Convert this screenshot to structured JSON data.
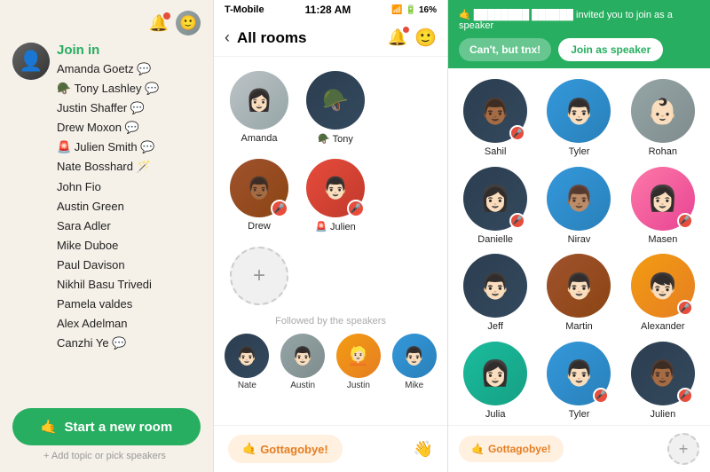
{
  "left": {
    "join_label": "Join in",
    "names": [
      "Amanda Goetz 💬",
      "🪖 Tony Lashley 💬",
      "Justin Shaffer 💬",
      "Drew Moxon 💬",
      "🚨 Julien Smith 💬",
      "Nate Bosshard 🪄",
      "John Fio",
      "Austin Green",
      "Sara Adler",
      "Mike Duboe",
      "Paul Davison",
      "Nikhil Basu Trivedi",
      "Pamela valdes",
      "Alex Adelman",
      "Canzhi Ye 💬"
    ],
    "start_room_btn": "Start a new room",
    "start_room_emoji": "🤙",
    "add_topic": "+ Add topic or pick speakers"
  },
  "middle": {
    "status_bar": {
      "carrier": "T-Mobile",
      "time": "11:28 AM",
      "battery": "16%"
    },
    "header_title": "All rooms",
    "speakers": [
      {
        "name": "Amanda",
        "mic_off": false,
        "color": "av-light"
      },
      {
        "name": "🪖 Tony",
        "mic_off": false,
        "color": "av-dark"
      },
      {
        "name": "Drew",
        "mic_off": true,
        "color": "av-brown"
      },
      {
        "name": "🚨 Julien",
        "mic_off": true,
        "color": "av-red"
      }
    ],
    "followed_label": "Followed by the speakers",
    "audience": [
      {
        "name": "Nate",
        "color": "av-dark"
      },
      {
        "name": "Austin",
        "color": "av-gray"
      },
      {
        "name": "Justin",
        "color": "av-warm"
      },
      {
        "name": "Mike",
        "color": "av-blue"
      }
    ],
    "gottagobye": "Gottagobye!",
    "gottagobye_emoji": "🤙"
  },
  "right": {
    "invite_text": "invited you to join as a speaker",
    "cant_btn": "Can't, but tnx!",
    "join_speaker_btn": "Join as speaker",
    "speakers": [
      {
        "name": "Sahil",
        "mic_off": true,
        "color": "av-dark"
      },
      {
        "name": "Tyler",
        "color": "av-blue",
        "mic_off": false
      },
      {
        "name": "Rohan",
        "color": "av-gray",
        "mic_off": false
      },
      {
        "name": "Danielle",
        "color": "av-dark",
        "mic_off": true
      },
      {
        "name": "Nirav",
        "color": "av-blue",
        "mic_off": false
      },
      {
        "name": "Masen",
        "color": "av-pink",
        "mic_off": true
      },
      {
        "name": "Jeff",
        "color": "av-dark",
        "mic_off": false
      },
      {
        "name": "Martin",
        "color": "av-brown",
        "mic_off": false
      },
      {
        "name": "Alexander",
        "color": "av-warm",
        "mic_off": true
      },
      {
        "name": "Julia",
        "color": "av-teal",
        "mic_off": false
      },
      {
        "name": "Tyler",
        "color": "av-blue",
        "mic_off": true
      },
      {
        "name": "Julien",
        "color": "av-dark",
        "mic_off": true
      }
    ],
    "gottagobye": "Gottagobye!",
    "gottagobye_emoji": "🤙"
  }
}
